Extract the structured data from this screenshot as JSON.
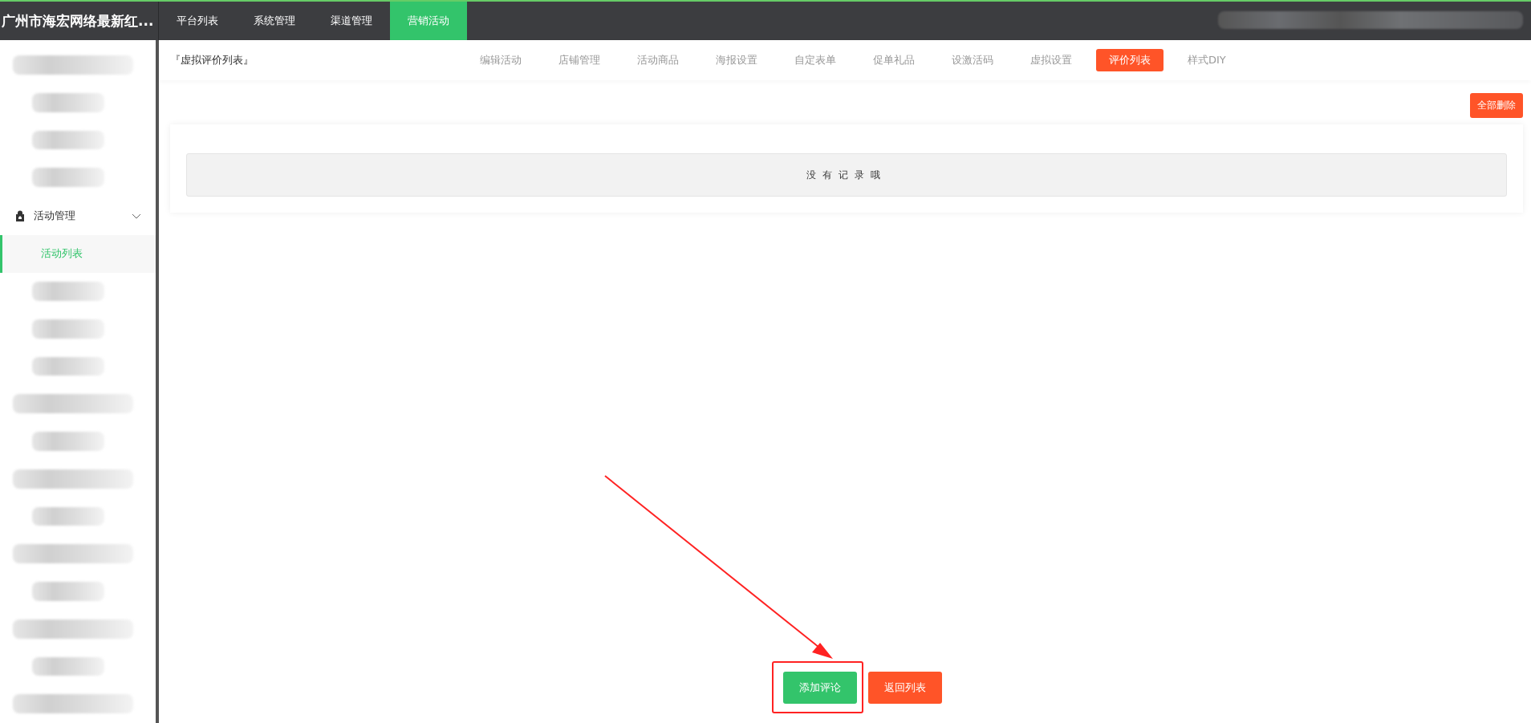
{
  "top_nav": {
    "brand": "广州市海宏网络最新红...",
    "tabs": [
      {
        "label": "平台列表",
        "selected": false
      },
      {
        "label": "系统管理",
        "selected": false
      },
      {
        "label": "渠道管理",
        "selected": false
      },
      {
        "label": "营销活动",
        "selected": true
      }
    ]
  },
  "sidebar": {
    "group": {
      "label": "活动管理",
      "expanded": true,
      "children": [
        {
          "label": "活动列表",
          "selected": true
        }
      ]
    }
  },
  "page": {
    "title": "『虚拟评价列表』",
    "tabs": [
      {
        "label": "编辑活动",
        "selected": false
      },
      {
        "label": "店铺管理",
        "selected": false
      },
      {
        "label": "活动商品",
        "selected": false
      },
      {
        "label": "海报设置",
        "selected": false
      },
      {
        "label": "自定表单",
        "selected": false
      },
      {
        "label": "促单礼品",
        "selected": false
      },
      {
        "label": "设激活码",
        "selected": false
      },
      {
        "label": "虚拟设置",
        "selected": false
      },
      {
        "label": "评价列表",
        "selected": true
      },
      {
        "label": "样式DIY",
        "selected": false
      }
    ],
    "delete_all_button": "全部删除",
    "empty_message": "没有记录哦",
    "actions": [
      {
        "label": "添加评论",
        "kind": "primary",
        "highlighted": true
      },
      {
        "label": "返回列表",
        "kind": "danger",
        "highlighted": false
      }
    ]
  }
}
